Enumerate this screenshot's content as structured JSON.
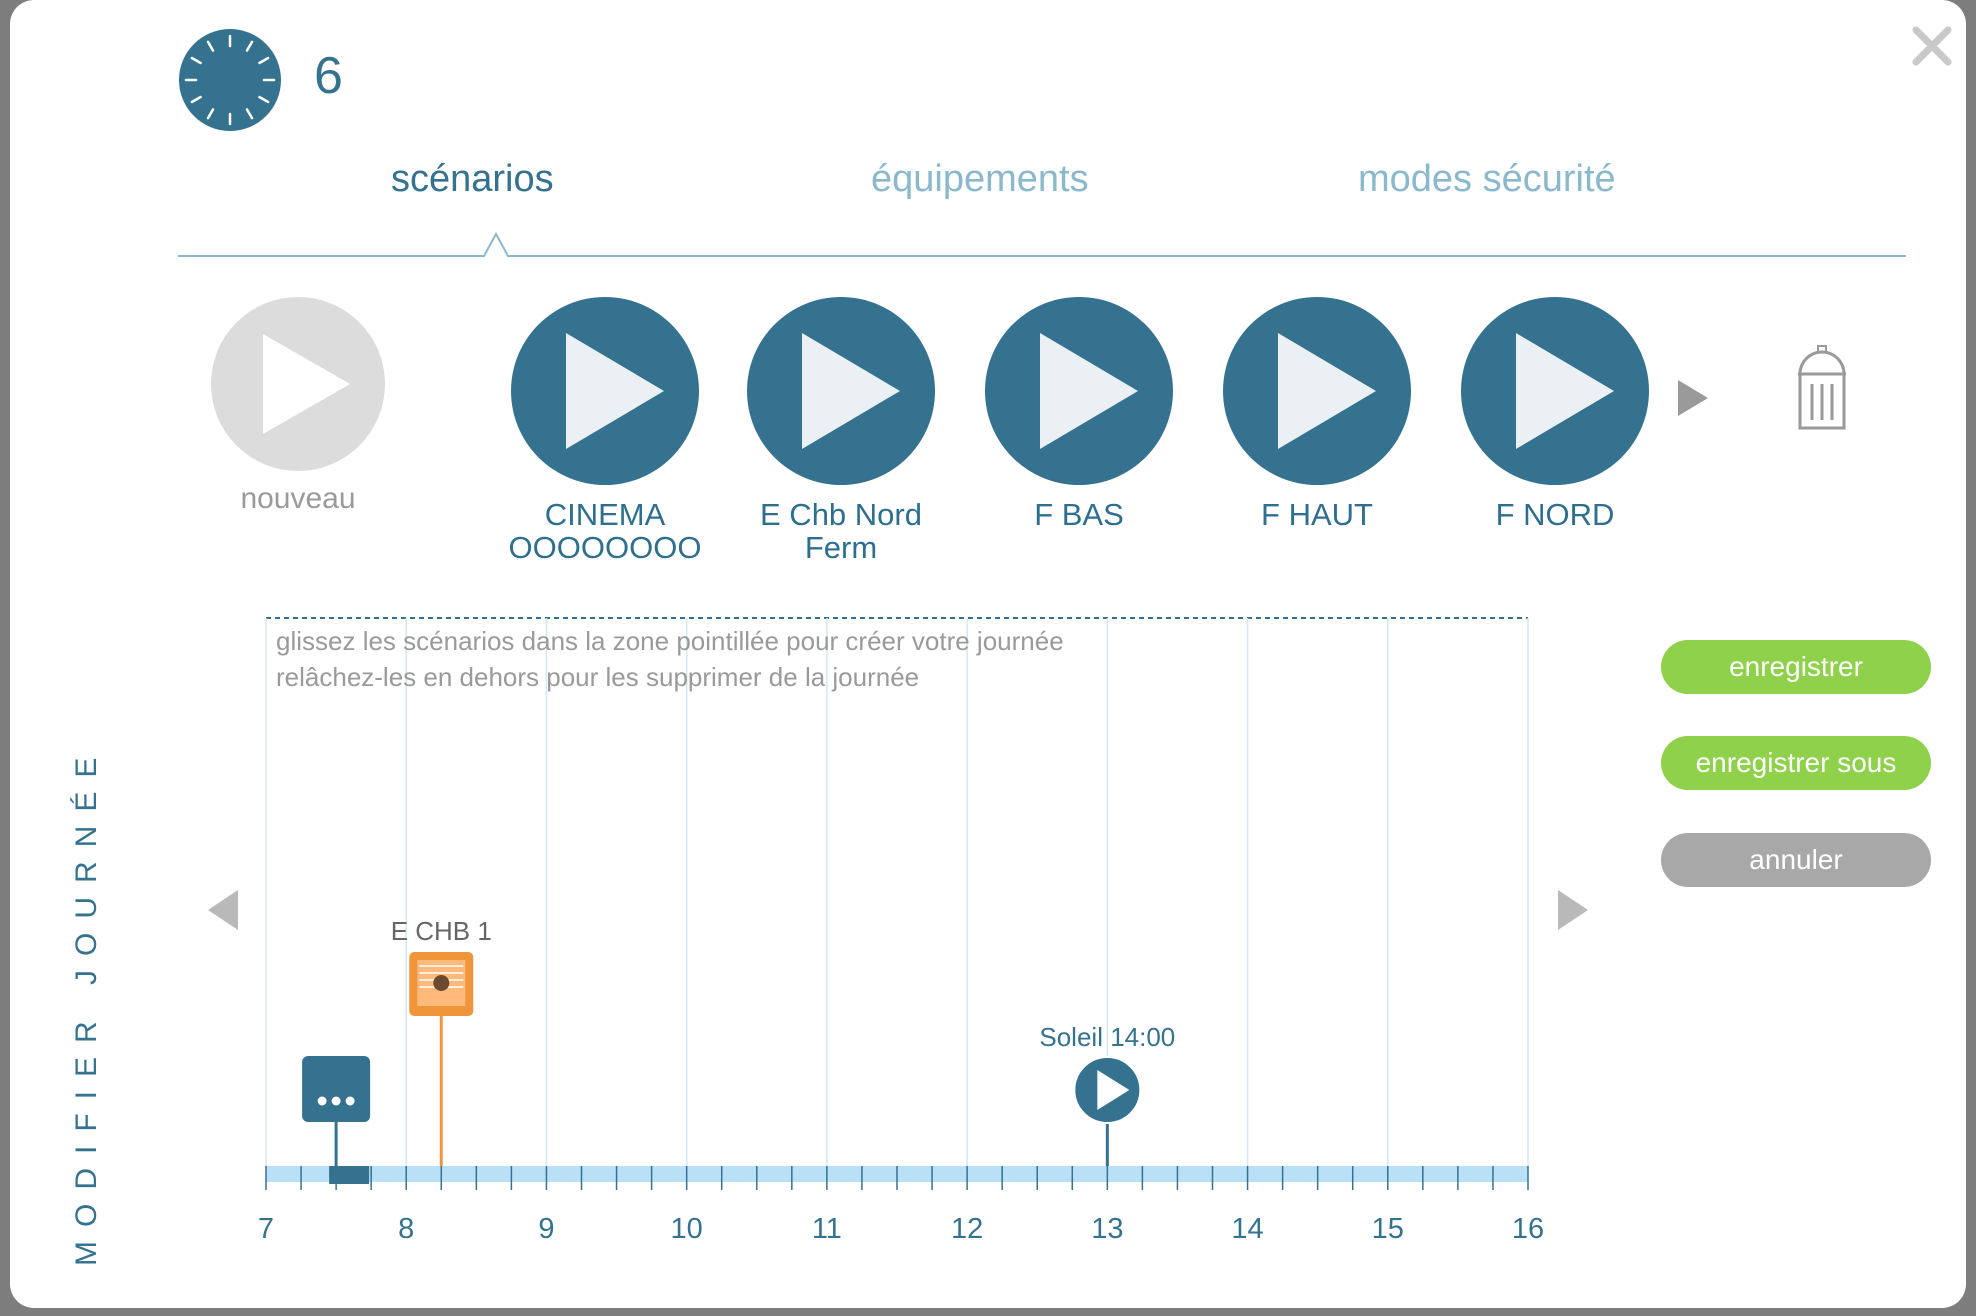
{
  "header": {
    "counter": "6"
  },
  "tabs": [
    {
      "label": "scénarios",
      "active": true
    },
    {
      "label": "équipements",
      "active": false
    },
    {
      "label": "modes sécurité",
      "active": false
    }
  ],
  "scenarios": {
    "new_label": "nouveau",
    "items": [
      {
        "label_line1": "CINEMA",
        "label_line2": "OOOOOOOO"
      },
      {
        "label_line1": "E Chb Nord",
        "label_line2": "Ferm"
      },
      {
        "label_line1": "F BAS",
        "label_line2": ""
      },
      {
        "label_line1": "F HAUT",
        "label_line2": ""
      },
      {
        "label_line1": "F NORD",
        "label_line2": ""
      }
    ]
  },
  "day_editor": {
    "side_title": "MODIFIER JOURNÉE",
    "hint_line1": "glissez les scénarios dans la zone pointillée pour créer votre journée",
    "hint_line2": "relâchez-les en dehors pour les supprimer de la journée",
    "hours": [
      "7",
      "8",
      "9",
      "10",
      "11",
      "12",
      "13",
      "14",
      "15",
      "16"
    ],
    "events": [
      {
        "label": "",
        "time_hours": 7.5,
        "icon": "more-dots-icon"
      },
      {
        "label": "E CHB 1",
        "time_hours": 8.25,
        "icon": "blind-my-icon"
      },
      {
        "label": "Soleil 14:00",
        "time_hours": 13.0,
        "icon": "play-icon"
      }
    ]
  },
  "actions": {
    "save": "enregistrer",
    "save_as": "enregistrer sous",
    "cancel": "annuler"
  },
  "colors": {
    "primary": "#34728f",
    "primary_light": "#8ab8cc",
    "green": "#8fd14a",
    "gray_button": "#a8a8a8",
    "orange": "#f0963a",
    "track": "#b9e0f7"
  }
}
